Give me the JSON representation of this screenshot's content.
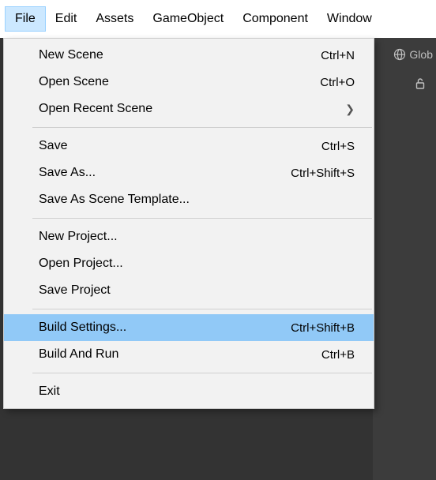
{
  "menubar": {
    "items": [
      {
        "label": "File",
        "active": true,
        "name": "menubar-file"
      },
      {
        "label": "Edit",
        "active": false,
        "name": "menubar-edit"
      },
      {
        "label": "Assets",
        "active": false,
        "name": "menubar-assets"
      },
      {
        "label": "GameObject",
        "active": false,
        "name": "menubar-gameobject"
      },
      {
        "label": "Component",
        "active": false,
        "name": "menubar-component"
      },
      {
        "label": "Window",
        "active": false,
        "name": "menubar-window"
      }
    ]
  },
  "toolbar": {
    "global_label": "Glob",
    "lock_glyph": "🔓"
  },
  "file_menu": {
    "groups": [
      [
        {
          "label": "New Scene",
          "shortcut": "Ctrl+N",
          "name": "menu-new-scene"
        },
        {
          "label": "Open Scene",
          "shortcut": "Ctrl+O",
          "name": "menu-open-scene"
        },
        {
          "label": "Open Recent Scene",
          "shortcut": "",
          "submenu": true,
          "name": "menu-open-recent-scene"
        }
      ],
      [
        {
          "label": "Save",
          "shortcut": "Ctrl+S",
          "name": "menu-save"
        },
        {
          "label": "Save As...",
          "shortcut": "Ctrl+Shift+S",
          "name": "menu-save-as"
        },
        {
          "label": "Save As Scene Template...",
          "shortcut": "",
          "name": "menu-save-as-scene-template"
        }
      ],
      [
        {
          "label": "New Project...",
          "shortcut": "",
          "name": "menu-new-project"
        },
        {
          "label": "Open Project...",
          "shortcut": "",
          "name": "menu-open-project"
        },
        {
          "label": "Save Project",
          "shortcut": "",
          "name": "menu-save-project"
        }
      ],
      [
        {
          "label": "Build Settings...",
          "shortcut": "Ctrl+Shift+B",
          "highlight": true,
          "name": "menu-build-settings"
        },
        {
          "label": "Build And Run",
          "shortcut": "Ctrl+B",
          "name": "menu-build-and-run"
        }
      ],
      [
        {
          "label": "Exit",
          "shortcut": "",
          "name": "menu-exit"
        }
      ]
    ]
  }
}
